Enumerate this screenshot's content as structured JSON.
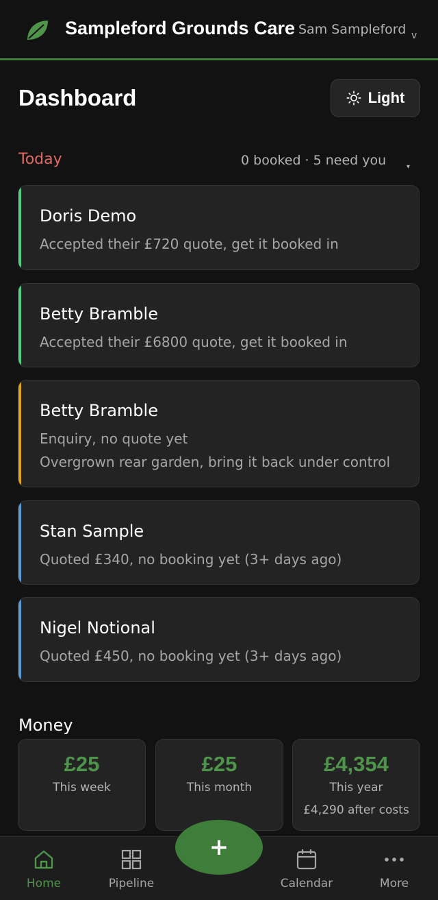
{
  "header": {
    "app_title": "Sampleford Grounds Care",
    "user_name": "Sam Sampleford",
    "user_chevron": "v",
    "accent": "#3f7d3a"
  },
  "page": {
    "title": "Dashboard",
    "theme_button_label": "Light"
  },
  "today": {
    "label": "Today",
    "summary": "0 booked · 5 need you",
    "caret": "▾",
    "items": [
      {
        "name": "Doris Demo",
        "lines": [
          "Accepted their £720 quote, get it booked in"
        ],
        "status": "accepted",
        "color": "#4fce84"
      },
      {
        "name": "Betty Bramble",
        "lines": [
          "Accepted their £6800 quote, get it booked in"
        ],
        "status": "accepted",
        "color": "#4fce84"
      },
      {
        "name": "Betty Bramble",
        "lines": [
          "Enquiry, no quote yet",
          "Overgrown rear garden, bring it back under control"
        ],
        "status": "enquiry",
        "color": "#e0a21a"
      },
      {
        "name": "Stan Sample",
        "lines": [
          "Quoted £340, no booking yet (3+ days ago)"
        ],
        "status": "quoted",
        "color": "#5a9bd5"
      },
      {
        "name": "Nigel Notional",
        "lines": [
          "Quoted £450, no booking yet (3+ days ago)"
        ],
        "status": "quoted",
        "color": "#5a9bd5"
      }
    ]
  },
  "money": {
    "heading": "Money",
    "stats": [
      {
        "amount": "£25",
        "label": "This week",
        "sub": ""
      },
      {
        "amount": "£25",
        "label": "This month",
        "sub": ""
      },
      {
        "amount": "£4,354",
        "label": "This year",
        "sub": "£4,290 after costs"
      }
    ]
  },
  "nav": {
    "home": "Home",
    "pipeline": "Pipeline",
    "add": "+",
    "calendar": "Calendar",
    "more": "More"
  }
}
